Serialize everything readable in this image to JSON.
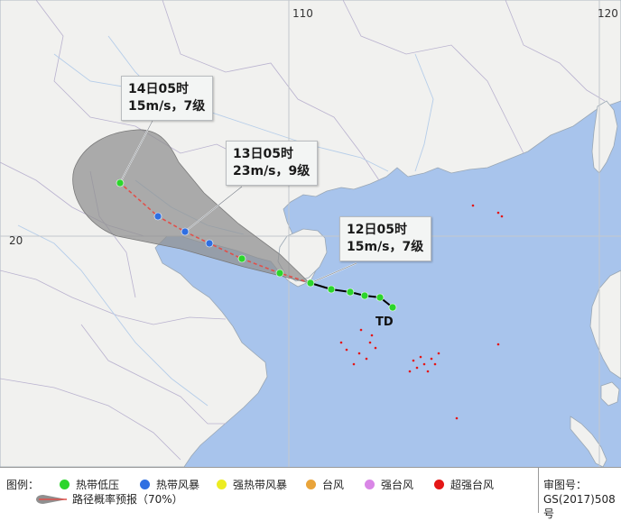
{
  "map": {
    "colors": {
      "sea": "#a8c4ec",
      "land": "#f1f1ef",
      "grid": "#c4c8cc",
      "cone": "#8f8f8f",
      "track_past": "#000000",
      "track_forecast": "#e0504a"
    },
    "coordinate_labels": {
      "lon_110": "110",
      "lon_120": "120",
      "lat_20": "20"
    },
    "storm_label": "TD",
    "callouts": [
      {
        "line1": "12日05时",
        "line2": "15m/s，7级"
      },
      {
        "line1": "13日05时",
        "line2": "23m/s，9级"
      },
      {
        "line1": "14日05时",
        "line2": "15m/s，7级"
      }
    ]
  },
  "legend": {
    "title": "图例：",
    "categories": [
      {
        "label": "热带低压",
        "color": "#2cd52c"
      },
      {
        "label": "热带风暴",
        "color": "#2f6fe2"
      },
      {
        "label": "强热带风暴",
        "color": "#ecec22"
      },
      {
        "label": "台风",
        "color": "#e9a43a"
      },
      {
        "label": "强台风",
        "color": "#d986e6"
      },
      {
        "label": "超强台风",
        "color": "#e41616"
      }
    ],
    "track_label": "路径概率预报（70%）",
    "approval_label": "审图号：",
    "approval_number": "GS(2017)508号"
  }
}
